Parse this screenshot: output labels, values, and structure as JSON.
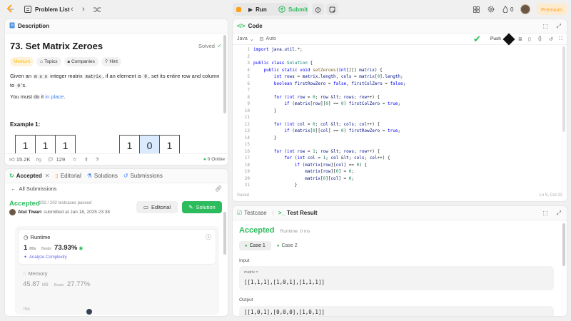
{
  "topbar": {
    "problem_list": "Problem List",
    "run": "Run",
    "submit": "Submit",
    "fire_count": "0",
    "premium": "Premium"
  },
  "description": {
    "tab": "Description",
    "title": "73. Set Matrix Zeroes",
    "status": "Solved",
    "difficulty": "Medium",
    "chips": [
      "Topics",
      "Companies",
      "Hint"
    ],
    "para1_a": "Given an",
    "para1_code1": "m x n",
    "para1_b": "integer matrix",
    "para1_code2": "matrix",
    "para1_c": ", if an element is",
    "para1_code3": "0",
    "para1_d": ", set its entire row and column to",
    "para1_code4": "0",
    "para1_e": "'s.",
    "para2_a": "You must do it",
    "para2_link": "in place",
    "para2_b": ".",
    "example_title": "Example 1:",
    "matrix_in": [
      "1",
      "1",
      "1"
    ],
    "matrix_out": [
      "1",
      "0",
      "1"
    ],
    "likes": "15.2K",
    "comments": "129",
    "online": "0 Online"
  },
  "code": {
    "tab": "Code",
    "language": "Java",
    "auto": "Auto",
    "push": "Push",
    "saved": "Saved",
    "cursor": "Ln 5, Col 22",
    "lines": [
      {
        "n": "1",
        "t": "import java.util.*;"
      },
      {
        "n": "2",
        "t": ""
      },
      {
        "n": "3",
        "t": "public class Solution {"
      },
      {
        "n": "4",
        "t": "    public static void setZeroes(int[][] matrix) {"
      },
      {
        "n": "5",
        "t": "        int rows = matrix.length, cols = matrix[0].length;"
      },
      {
        "n": "6",
        "t": "        boolean firstRowZero = false, firstColZero = false;"
      },
      {
        "n": "7",
        "t": ""
      },
      {
        "n": "8",
        "t": "        for (int row = 0; row < rows; row++) {"
      },
      {
        "n": "9",
        "t": "            if (matrix[row][0] == 0) firstColZero = true;"
      },
      {
        "n": "10",
        "t": "        }"
      },
      {
        "n": "11",
        "t": ""
      },
      {
        "n": "12",
        "t": "        for (int col = 0; col < cols; col++) {"
      },
      {
        "n": "13",
        "t": "            if (matrix[0][col] == 0) firstRowZero = true;"
      },
      {
        "n": "14",
        "t": "        }"
      },
      {
        "n": "15",
        "t": ""
      },
      {
        "n": "16",
        "t": "        for (int row = 1; row < rows; row++) {"
      },
      {
        "n": "17",
        "t": "            for (int col = 1; col < cols; col++) {"
      },
      {
        "n": "18",
        "t": "                if (matrix[row][col] == 0) {"
      },
      {
        "n": "19",
        "t": "                    matrix[row][0] = 0;"
      },
      {
        "n": "20",
        "t": "                    matrix[0][col] = 0;"
      },
      {
        "n": "21",
        "t": "                }"
      }
    ]
  },
  "submission": {
    "tabs": [
      "Accepted",
      "Editorial",
      "Solutions",
      "Submissions"
    ],
    "all_submissions": "All Submissions",
    "status": "Accepted",
    "cases": "202 / 202 testcases passed",
    "author": "Atul Tiwari",
    "submitted": "submitted at Jan 18, 2025 23:38",
    "editorial_btn": "Editorial",
    "solution_btn": "Solution",
    "runtime_label": "Runtime",
    "runtime_value": "1",
    "runtime_unit": "ms",
    "beats_label": "Beats",
    "beats_value": "73.93%",
    "analyze": "Analyze Complexity",
    "memory_label": "Memory",
    "memory_value": "45.87",
    "memory_unit": "MB",
    "memory_beats_label": "Beats",
    "memory_beats": "27.77%",
    "chart_tick": "75%"
  },
  "result": {
    "tab_testcase": "Testcase",
    "tab_result": "Test Result",
    "status": "Accepted",
    "runtime": "Runtime: 0 ms",
    "case1": "Case 1",
    "case2": "Case 2",
    "input_label": "Input",
    "input_name": "matrix =",
    "input_value": "[[1,1,1],[1,0,1],[1,1,1]]",
    "output_label": "Output",
    "output_value": "[[1,0,1],[0,0,0],[1,0,1]]"
  },
  "colors": {
    "accent_green": "#2cbb5d",
    "premium": "#ffa116",
    "medium": "#ffb800"
  }
}
